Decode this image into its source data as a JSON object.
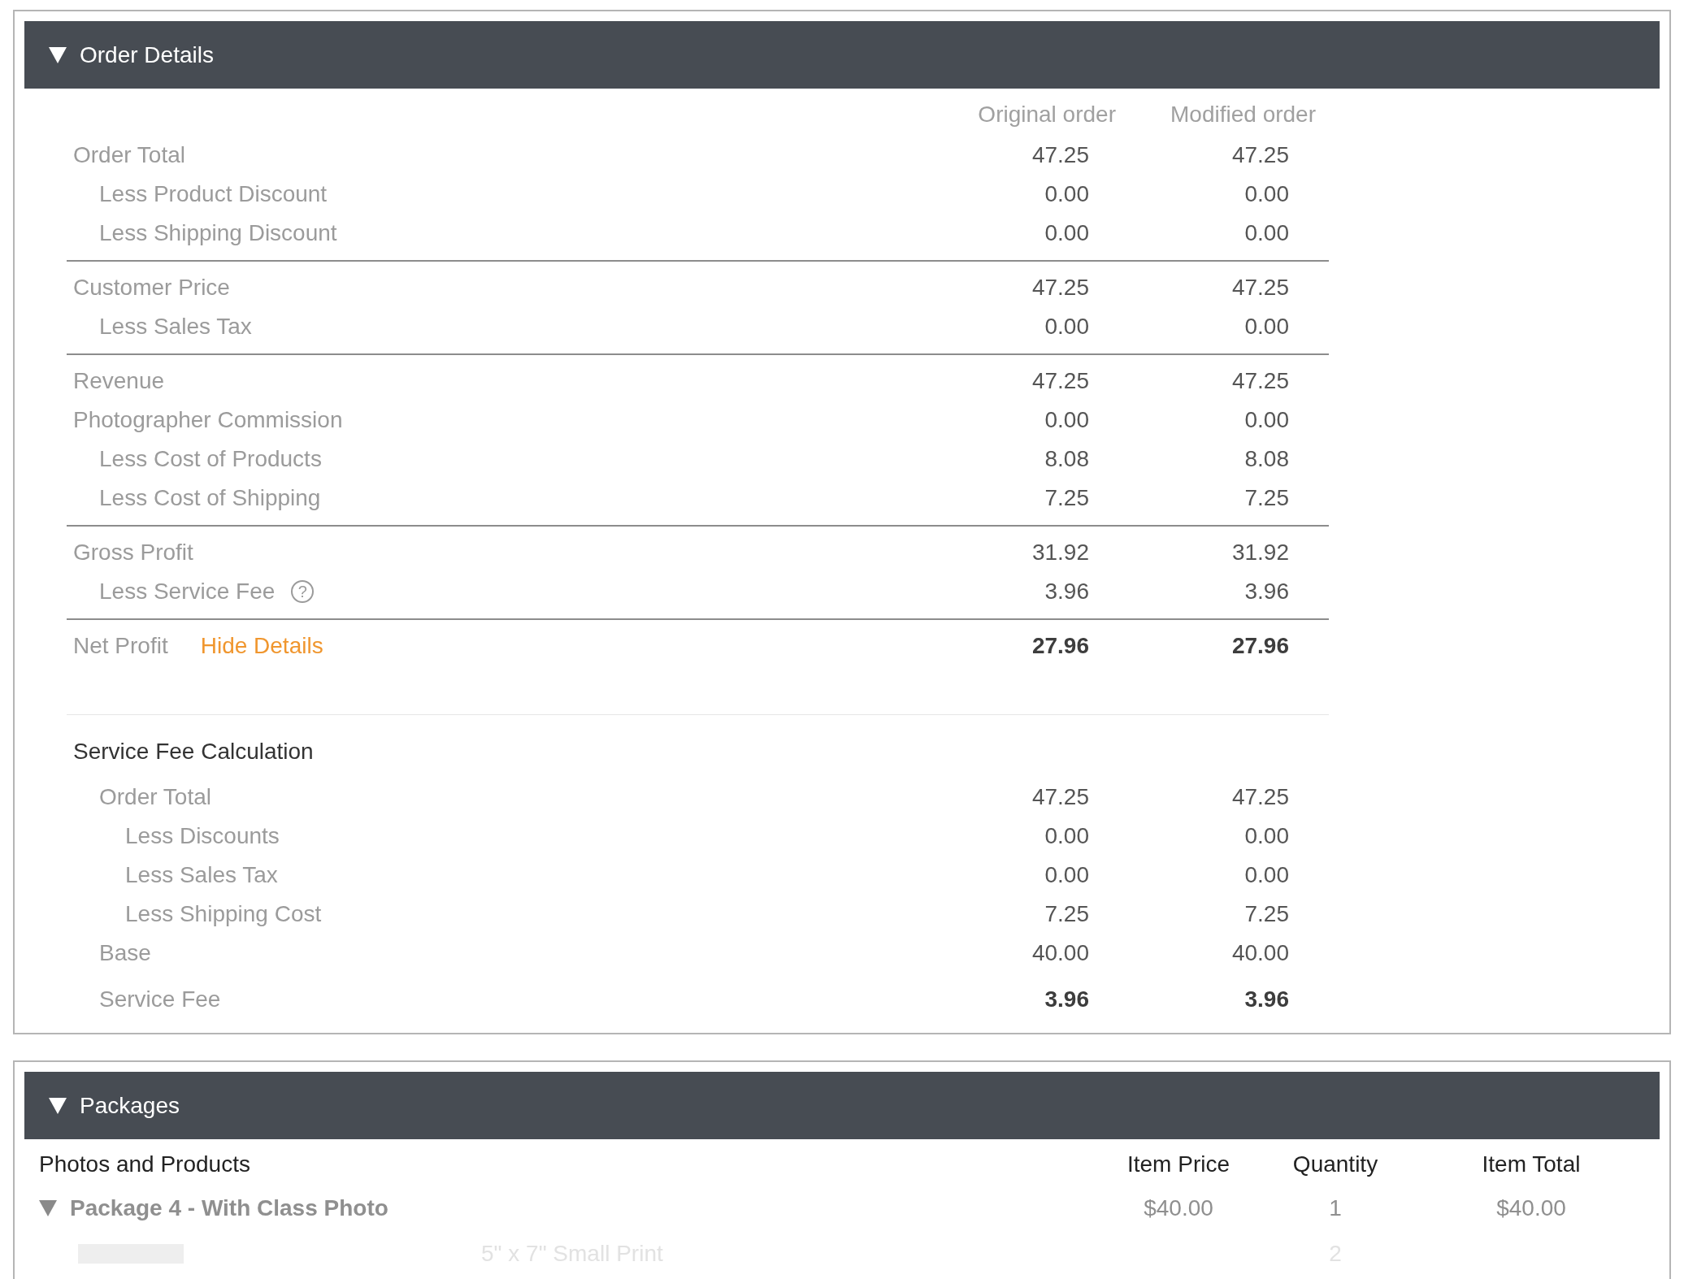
{
  "order_details": {
    "title": "Order Details",
    "expanded": true,
    "column_headers": [
      "Original order",
      "Modified order"
    ],
    "groups": [
      {
        "rows": [
          {
            "label": "Order Total",
            "original": "47.25",
            "modified": "47.25",
            "bold": false,
            "children": [
              {
                "label": "Less Product Discount",
                "original": "0.00",
                "modified": "0.00",
                "bold": false
              },
              {
                "label": "Less Shipping Discount",
                "original": "0.00",
                "modified": "0.00",
                "bold": false
              }
            ]
          }
        ]
      },
      {
        "rows": [
          {
            "label": "Customer Price",
            "original": "47.25",
            "modified": "47.25",
            "bold": false,
            "children": [
              {
                "label": "Less Sales Tax",
                "original": "0.00",
                "modified": "0.00",
                "bold": false
              }
            ]
          }
        ]
      },
      {
        "rows": [
          {
            "label": "Revenue",
            "original": "47.25",
            "modified": "47.25",
            "bold": false
          },
          {
            "label": "Photographer Commission",
            "original": "0.00",
            "modified": "0.00",
            "bold": false,
            "children": [
              {
                "label": "Less Cost of Products",
                "original": "8.08",
                "modified": "8.08",
                "bold": false
              },
              {
                "label": "Less Cost of Shipping",
                "original": "7.25",
                "modified": "7.25",
                "bold": false
              }
            ]
          }
        ]
      },
      {
        "rows": [
          {
            "label": "Gross Profit",
            "original": "31.92",
            "modified": "31.92",
            "bold": false,
            "children": [
              {
                "label": "Less Service Fee",
                "help_icon": "?",
                "original": "3.96",
                "modified": "3.96",
                "bold": false
              }
            ]
          }
        ]
      },
      {
        "rows": [
          {
            "label": "Net Profit",
            "link": "Hide Details",
            "original": "27.96",
            "modified": "27.96",
            "bold": true
          }
        ]
      }
    ],
    "service_fee": {
      "title": "Service Fee Calculation",
      "rows": [
        {
          "label": "Order Total",
          "original": "47.25",
          "modified": "47.25",
          "bold": false,
          "children": [
            {
              "label": "Less Discounts",
              "original": "0.00",
              "modified": "0.00",
              "bold": false
            },
            {
              "label": "Less Sales Tax",
              "original": "0.00",
              "modified": "0.00",
              "bold": false
            },
            {
              "label": "Less Shipping Cost",
              "original": "7.25",
              "modified": "7.25",
              "bold": false
            }
          ]
        },
        {
          "label": "Base",
          "original": "40.00",
          "modified": "40.00",
          "bold": false
        },
        {
          "label": "Service Fee",
          "original": "3.96",
          "modified": "3.96",
          "bold": true
        }
      ]
    }
  },
  "packages": {
    "title": "Packages",
    "expanded": true,
    "columns": [
      "Photos and Products",
      "Item Price",
      "Quantity",
      "Item Total"
    ],
    "rows": [
      {
        "name": "Package 4 - With Class Photo",
        "expanded": true,
        "price": "$40.00",
        "quantity": "1",
        "total": "$40.00",
        "children": [
          {
            "name": "5\" x 7\" Small Print",
            "quantity": "2"
          }
        ]
      }
    ]
  }
}
